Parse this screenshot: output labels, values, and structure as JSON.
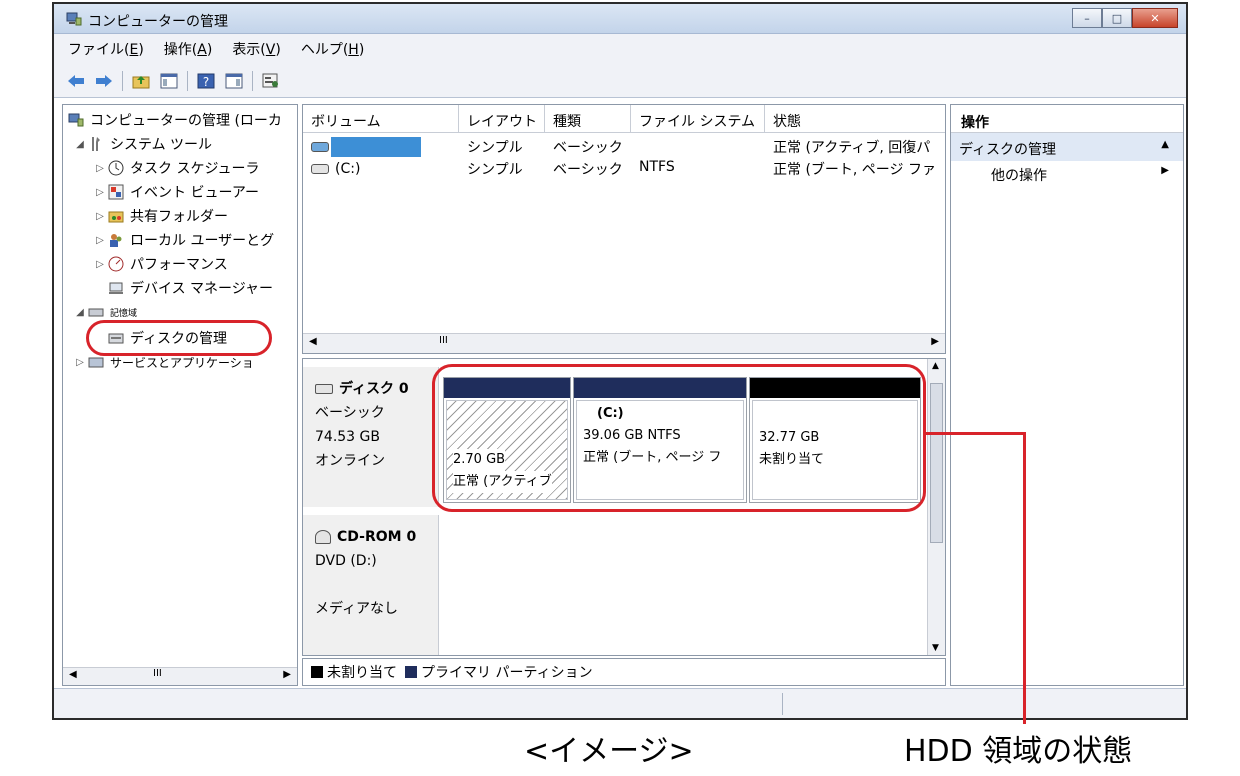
{
  "window": {
    "title": "コンピューターの管理",
    "min_glyph": "–",
    "max_glyph": "□",
    "close_glyph": "✕"
  },
  "menu": [
    {
      "label": "ファイル(",
      "key": "E",
      "tail": ")"
    },
    {
      "label": "操作(",
      "key": "A",
      "tail": ")"
    },
    {
      "label": "表示(",
      "key": "V",
      "tail": ")"
    },
    {
      "label": "ヘルプ(",
      "key": "H",
      "tail": ")"
    }
  ],
  "tree": {
    "root": "コンピューターの管理 (ローカ",
    "system_tools": "システム ツール",
    "task_scheduler": "タスク スケジューラ",
    "event_viewer": "イベント ビューアー",
    "shared_folders": "共有フォルダー",
    "local_users": "ローカル ユーザーとグ",
    "performance": "パフォーマンス",
    "device_manager": "デバイス マネージャー",
    "storage": "記憶域",
    "disk_management": "ディスクの管理",
    "services": "サービスとアプリケーショ"
  },
  "volumes": {
    "headers": [
      "ボリューム",
      "レイアウト",
      "種類",
      "ファイル システム",
      "状態"
    ],
    "rows": [
      {
        "volume": "",
        "layout": "シンプル",
        "type": "ベーシック",
        "fs": "",
        "status": "正常 (アクティブ, 回復パ"
      },
      {
        "volume": "(C:)",
        "layout": "シンプル",
        "type": "ベーシック",
        "fs": "NTFS",
        "status": "正常 (ブート, ページ ファ"
      }
    ],
    "scroll_mark": "III"
  },
  "disk0": {
    "name": "ディスク 0",
    "kind": "ベーシック",
    "size": "74.53 GB",
    "state": "オンライン",
    "partitions": [
      {
        "label": "",
        "size": "2.70 GB",
        "status": "正常 (アクティブ"
      },
      {
        "label": "(C:)",
        "size": "39.06 GB NTFS",
        "status": "正常 (ブート, ページ フ"
      },
      {
        "label": "",
        "size": "32.77 GB",
        "status": "未割り当て"
      }
    ]
  },
  "cdrom": {
    "name": "CD-ROM 0",
    "drive": "DVD (D:)",
    "media": "メディアなし"
  },
  "legend": {
    "unallocated": "未割り当て",
    "primary": "プライマリ パーティション"
  },
  "actions": {
    "title": "操作",
    "section": "ディスクの管理",
    "section_glyph": "▲",
    "other": "他の操作",
    "other_glyph": "▶"
  },
  "tree_scroll_mark": "III",
  "captions": {
    "image": "<イメージ>",
    "hdd": "HDD 領域の状態"
  },
  "colors": {
    "accent_red": "#d8232a",
    "primary_partition": "#1f2d5c",
    "unallocated": "#000000"
  }
}
